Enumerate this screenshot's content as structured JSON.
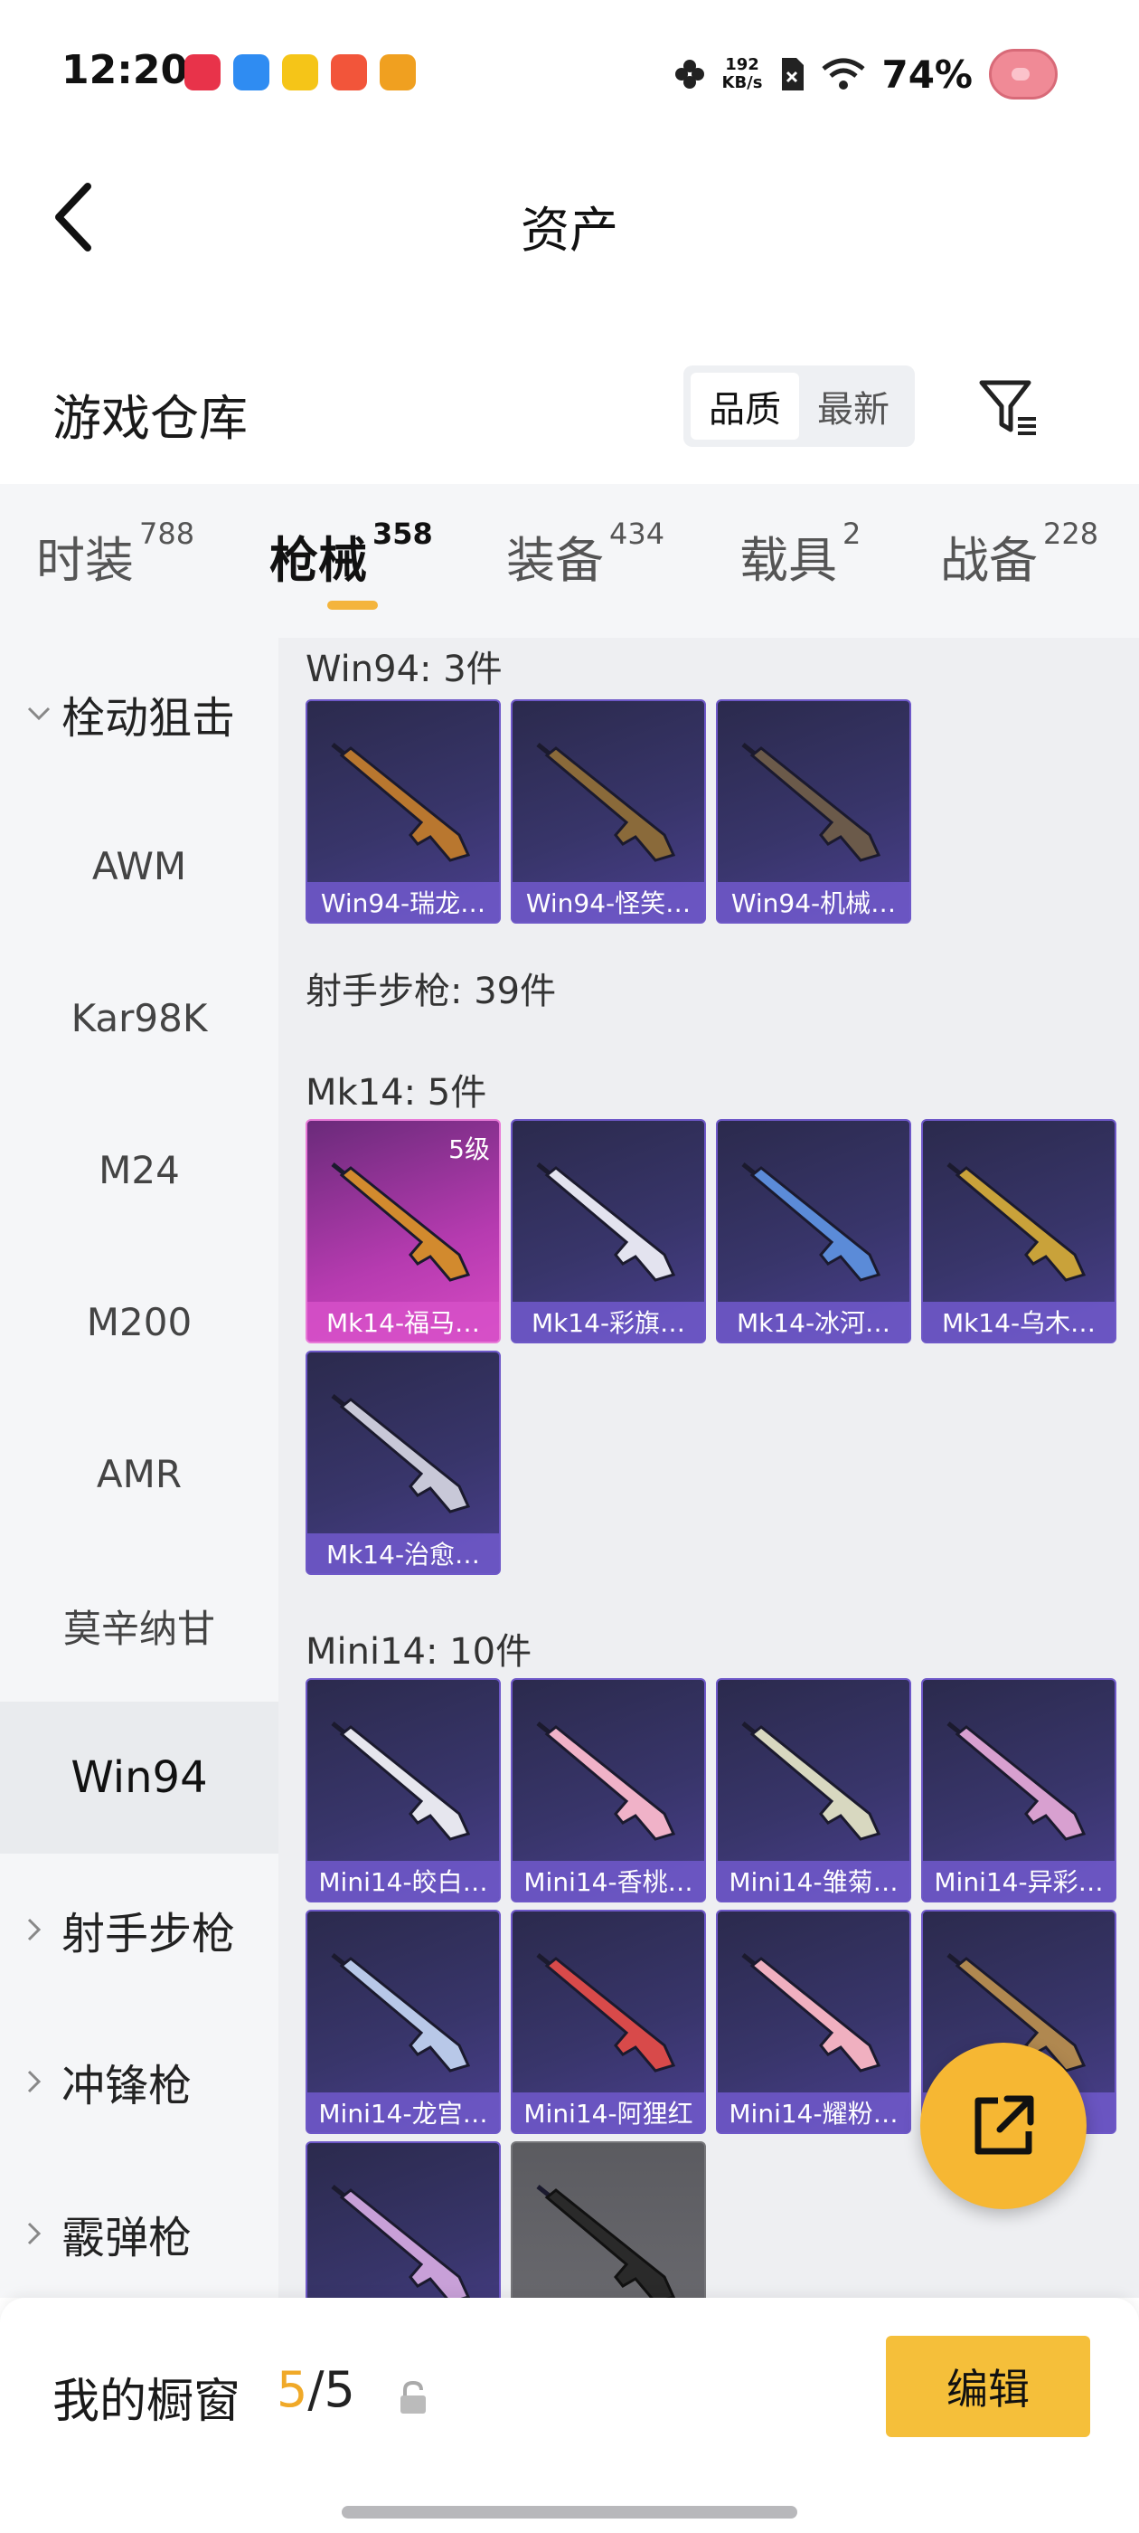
{
  "status_bar": {
    "time": "12:20",
    "net_speed_value": "192",
    "net_speed_unit": "KB/s",
    "battery": "74%",
    "app_icon_colors": [
      "#e8334a",
      "#2f8cf2",
      "#f5c518",
      "#f2553a",
      "#f0a020"
    ]
  },
  "header": {
    "title": "资产"
  },
  "section": {
    "title": "游戏仓库",
    "sort_options": [
      "品质",
      "最新"
    ],
    "sort_selected": "品质"
  },
  "tabs": [
    {
      "label": "时装",
      "count": "788"
    },
    {
      "label": "枪械",
      "count": "358",
      "active": true
    },
    {
      "label": "装备",
      "count": "434"
    },
    {
      "label": "载具",
      "count": "2"
    },
    {
      "label": "战备",
      "count": "228"
    }
  ],
  "sidebar": {
    "items": [
      {
        "label": "栓动狙击",
        "type": "group",
        "expanded": true
      },
      {
        "label": "AWM",
        "type": "item"
      },
      {
        "label": "Kar98K",
        "type": "item"
      },
      {
        "label": "M24",
        "type": "item"
      },
      {
        "label": "M200",
        "type": "item"
      },
      {
        "label": "AMR",
        "type": "item"
      },
      {
        "label": "莫辛纳甘",
        "type": "item"
      },
      {
        "label": "Win94",
        "type": "item",
        "selected": true
      },
      {
        "label": "射手步枪",
        "type": "group",
        "expanded": false
      },
      {
        "label": "冲锋枪",
        "type": "group",
        "expanded": false
      },
      {
        "label": "霰弹枪",
        "type": "group",
        "expanded": false
      }
    ]
  },
  "content": {
    "groups": [
      {
        "label": "Win94: 3件",
        "items": [
          {
            "name": "Win94-瑞龙…",
            "gun_color": "#b9772f"
          },
          {
            "name": "Win94-怪笑…",
            "gun_color": "#8a6a3a"
          },
          {
            "name": "Win94-机械…",
            "gun_color": "#6b5a4a"
          }
        ]
      },
      {
        "label": "射手步枪: 39件",
        "items": []
      },
      {
        "label": "Mk14: 5件",
        "items": [
          {
            "name": "Mk14-福马…",
            "gun_color": "#d28a2e",
            "level": "5级",
            "rarity": "gold"
          },
          {
            "name": "Mk14-彩旗…",
            "gun_color": "#e3e3ef"
          },
          {
            "name": "Mk14-冰河…",
            "gun_color": "#5b8bd8"
          },
          {
            "name": "Mk14-乌木…",
            "gun_color": "#c9a23a"
          },
          {
            "name": "Mk14-治愈…",
            "gun_color": "#c8c8d8"
          }
        ]
      },
      {
        "label": "Mini14: 10件",
        "items": [
          {
            "name": "Mini14-皎白…",
            "gun_color": "#e6e6ee"
          },
          {
            "name": "Mini14-香桃…",
            "gun_color": "#f0b2c8"
          },
          {
            "name": "Mini14-雏菊…",
            "gun_color": "#d8d8c0"
          },
          {
            "name": "Mini14-异彩…",
            "gun_color": "#d8a0d0"
          },
          {
            "name": "Mini14-龙宫…",
            "gun_color": "#b8c8e8"
          },
          {
            "name": "Mini14-阿狸红",
            "gun_color": "#d84a4a"
          },
          {
            "name": "Mini14-耀粉…",
            "gun_color": "#f0b0c0"
          },
          {
            "name": "Mini14-…",
            "gun_color": "#b08850"
          },
          {
            "name": "",
            "gun_color": "#c8a0d8"
          },
          {
            "name": "",
            "gun_color": "#2a2a2a",
            "rarity": "grey"
          }
        ]
      }
    ]
  },
  "bottom_bar": {
    "title": "我的橱窗",
    "count_current": "5",
    "count_total": "/5",
    "edit_label": "编辑"
  },
  "colors": {
    "accent": "#f5bf3a",
    "tab_underline": "#f4b43c",
    "card_border": "#6e58c8",
    "card_gold": "#d84bc4"
  }
}
